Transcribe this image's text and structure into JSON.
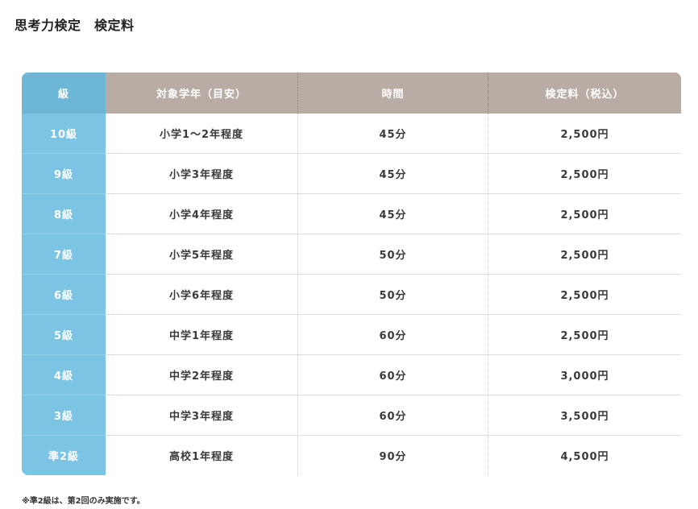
{
  "page_title": "思考力検定　検定料",
  "table": {
    "headers": {
      "grade": "級",
      "target": "対象学年（目安）",
      "time": "時間",
      "fee": "検定料（税込）"
    },
    "rows": [
      {
        "grade": "10級",
        "target": "小学1〜2年程度",
        "time": "45分",
        "fee": "2,500円"
      },
      {
        "grade": "9級",
        "target": "小学3年程度",
        "time": "45分",
        "fee": "2,500円"
      },
      {
        "grade": "8級",
        "target": "小学4年程度",
        "time": "45分",
        "fee": "2,500円"
      },
      {
        "grade": "7級",
        "target": "小学5年程度",
        "time": "50分",
        "fee": "2,500円"
      },
      {
        "grade": "6級",
        "target": "小学6年程度",
        "time": "50分",
        "fee": "2,500円"
      },
      {
        "grade": "5級",
        "target": "中学1年程度",
        "time": "60分",
        "fee": "2,500円"
      },
      {
        "grade": "4級",
        "target": "中学2年程度",
        "time": "60分",
        "fee": "3,000円"
      },
      {
        "grade": "3級",
        "target": "中学3年程度",
        "time": "60分",
        "fee": "3,500円"
      },
      {
        "grade": "準2級",
        "target": "高校1年程度",
        "time": "90分",
        "fee": "4,500円"
      }
    ]
  },
  "footnote": "※準2級は、第2回のみ実施です。",
  "colors": {
    "grade_column": "#7cc4e4",
    "grade_header": "#6cb6d8",
    "header_row": "#b8aca5"
  }
}
